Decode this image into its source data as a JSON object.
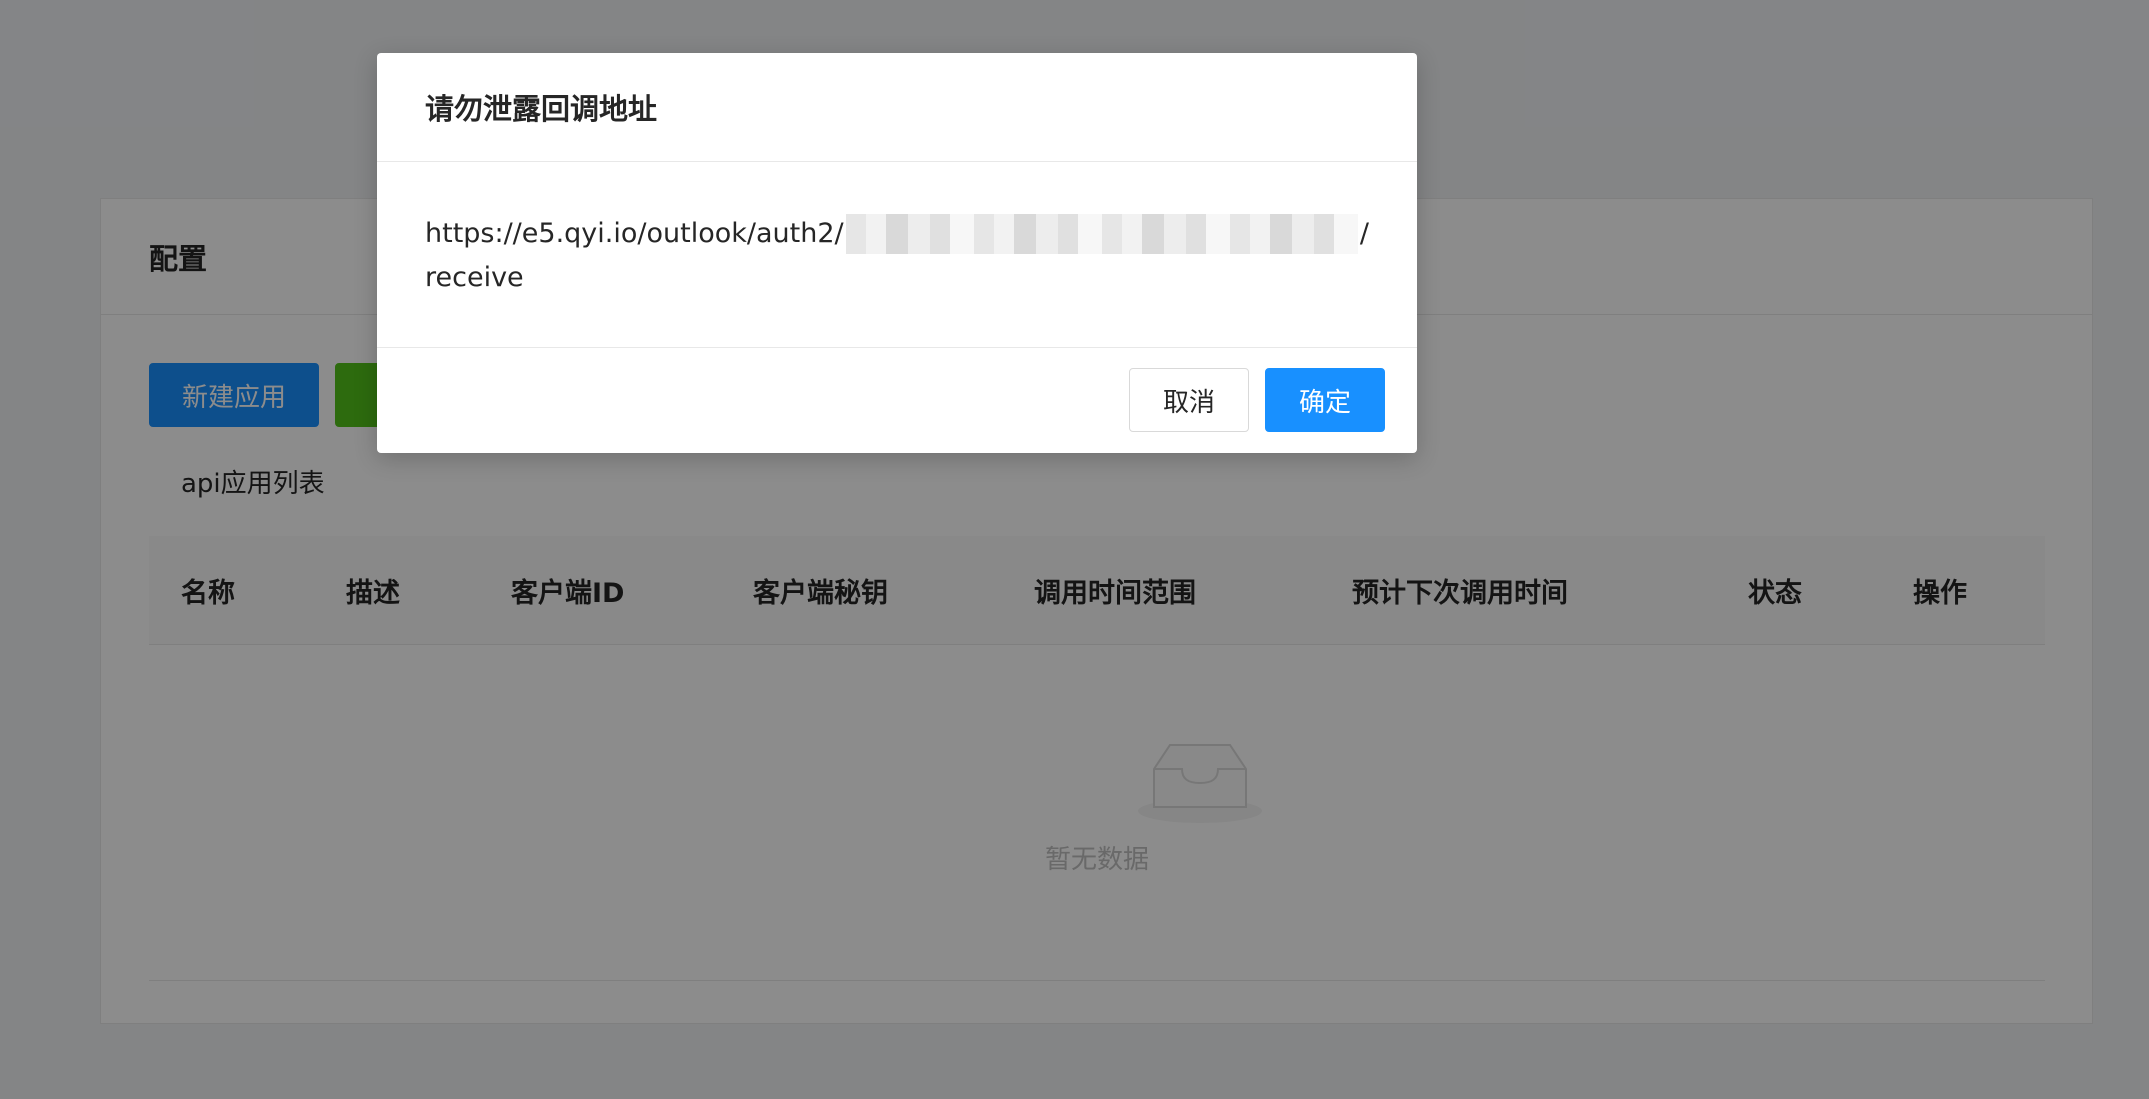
{
  "card": {
    "title": "配置",
    "buttons": {
      "new_app": "新建应用",
      "second": ""
    },
    "list_title": "api应用列表",
    "table": {
      "columns": [
        "名称",
        "描述",
        "客户端ID",
        "客户端秘钥",
        "调用时间范围",
        "预计下次调用时间",
        "状态",
        "操作"
      ],
      "empty_text": "暂无数据"
    }
  },
  "modal": {
    "title": "请勿泄露回调地址",
    "url_prefix": "https://e5.qyi.io/outlook/auth2/",
    "url_suffix": "/",
    "url_line2": "receive",
    "cancel_label": "取消",
    "ok_label": "确定"
  },
  "colors": {
    "primary": "#1890ff",
    "success": "#52c41a",
    "mask": "rgba(0,0,0,0.45)"
  }
}
